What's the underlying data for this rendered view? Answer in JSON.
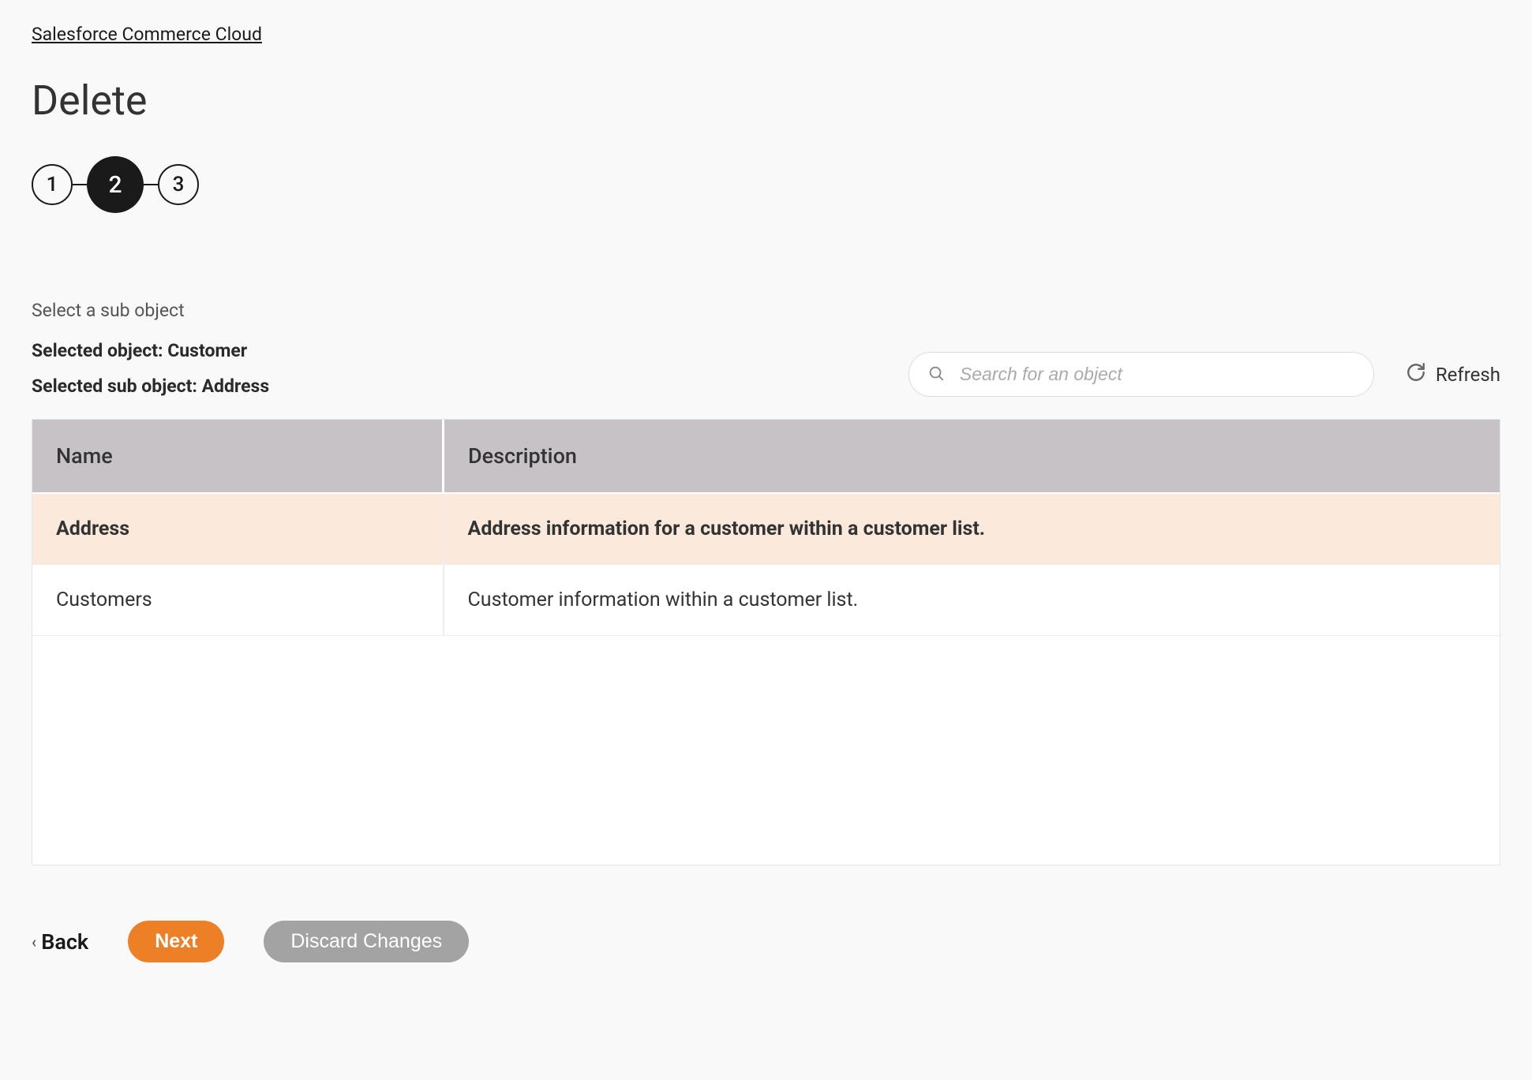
{
  "breadcrumb": "Salesforce Commerce Cloud",
  "page_title": "Delete",
  "stepper": {
    "steps": [
      "1",
      "2",
      "3"
    ],
    "active_index": 1
  },
  "prompt": "Select a sub object",
  "selected_object_label": "Selected object: Customer",
  "selected_sub_object_label": "Selected sub object: Address",
  "search": {
    "placeholder": "Search for an object",
    "value": ""
  },
  "refresh_label": "Refresh",
  "table": {
    "columns": [
      "Name",
      "Description"
    ],
    "rows": [
      {
        "name": "Address",
        "description": "Address information for a customer within a customer list.",
        "selected": true
      },
      {
        "name": "Customers",
        "description": "Customer information within a customer list.",
        "selected": false
      }
    ]
  },
  "footer": {
    "back": "Back",
    "next": "Next",
    "discard": "Discard Changes"
  }
}
